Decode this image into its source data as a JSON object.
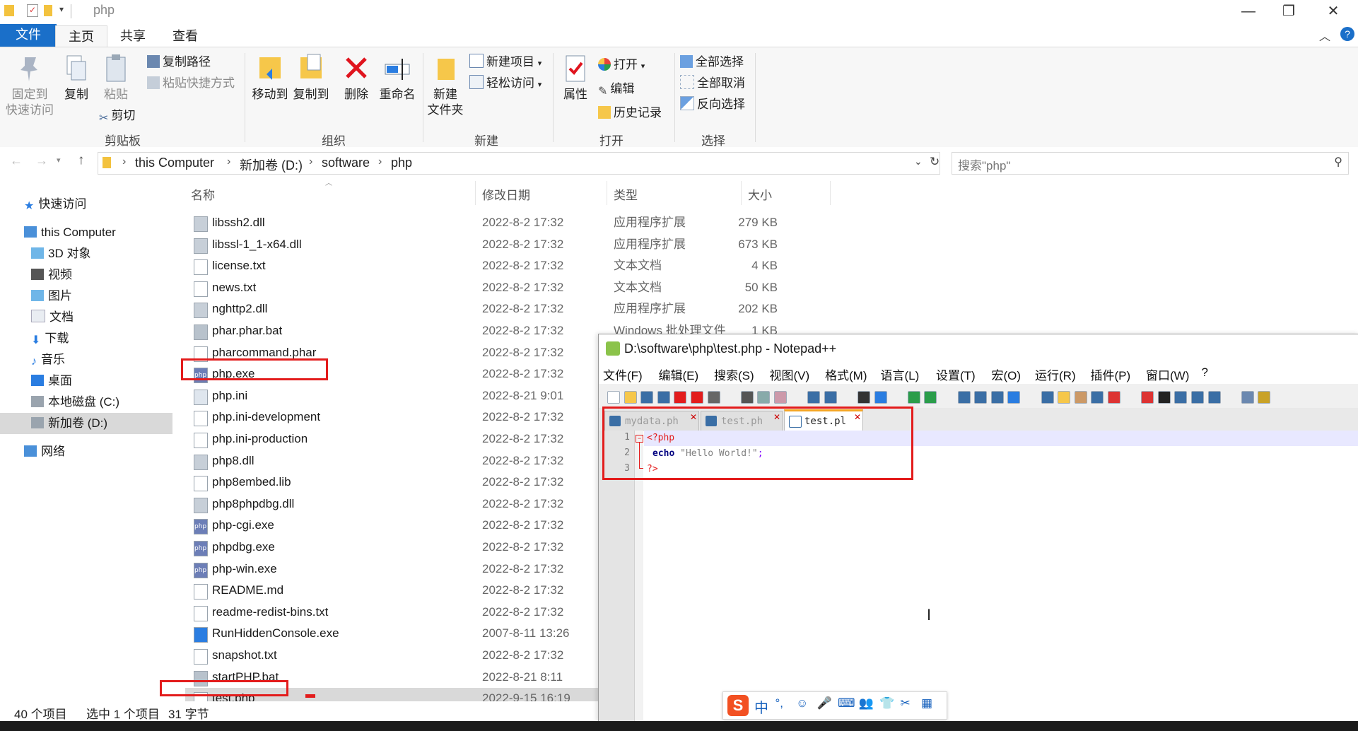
{
  "window": {
    "title": "php",
    "controls": {
      "minimize": "—",
      "maximize": "❐",
      "close": "✕"
    }
  },
  "tabs": {
    "file": "文件",
    "home": "主页",
    "share": "共享",
    "view": "查看"
  },
  "ribbon": {
    "pin": [
      "固定到",
      "快速访问"
    ],
    "copy": "复制",
    "paste": "粘贴",
    "copy_path": "复制路径",
    "paste_shortcut": "粘贴快捷方式",
    "cut": "剪切",
    "group_clipboard": "剪贴板",
    "move_to": "移动到",
    "copy_to": "复制到",
    "delete": "删除",
    "rename": "重命名",
    "group_organize": "组织",
    "new_folder": [
      "新建",
      "文件夹"
    ],
    "new_item": "新建项目",
    "easy_access": "轻松访问",
    "group_new": "新建",
    "properties": "属性",
    "open": "打开",
    "edit": "编辑",
    "history": "历史记录",
    "group_open": "打开",
    "select_all": "全部选择",
    "select_none": "全部取消",
    "invert_selection": "反向选择",
    "group_select": "选择"
  },
  "address": {
    "crumbs": [
      "this Computer",
      "新加卷 (D:)",
      "software",
      "php"
    ],
    "search_placeholder": "搜索\"php\""
  },
  "nav": {
    "items": [
      "快速访问",
      "this Computer",
      "3D 对象",
      "视频",
      "图片",
      "文档",
      "下载",
      "音乐",
      "桌面",
      "本地磁盘 (C:)",
      "新加卷 (D:)",
      "网络"
    ]
  },
  "list": {
    "headers": {
      "name": "名称",
      "date": "修改日期",
      "type": "类型",
      "size": "大小"
    },
    "rows": [
      {
        "name": "libssh2.dll",
        "date": "2022-8-2 17:32",
        "type": "应用程序扩展",
        "size": "279 KB",
        "icon": "dll"
      },
      {
        "name": "libssl-1_1-x64.dll",
        "date": "2022-8-2 17:32",
        "type": "应用程序扩展",
        "size": "673 KB",
        "icon": "dll"
      },
      {
        "name": "license.txt",
        "date": "2022-8-2 17:32",
        "type": "文本文档",
        "size": "4 KB",
        "icon": "txt"
      },
      {
        "name": "news.txt",
        "date": "2022-8-2 17:32",
        "type": "文本文档",
        "size": "50 KB",
        "icon": "txt"
      },
      {
        "name": "nghttp2.dll",
        "date": "2022-8-2 17:32",
        "type": "应用程序扩展",
        "size": "202 KB",
        "icon": "dll"
      },
      {
        "name": "phar.phar.bat",
        "date": "2022-8-2 17:32",
        "type": "Windows 批处理文件",
        "size": "1 KB",
        "icon": "bat"
      },
      {
        "name": "pharcommand.phar",
        "date": "2022-8-2 17:32",
        "icon": "txt"
      },
      {
        "name": "php.exe",
        "date": "2022-8-2 17:32",
        "icon": "php"
      },
      {
        "name": "php.ini",
        "date": "2022-8-21 9:01",
        "icon": "ini"
      },
      {
        "name": "php.ini-development",
        "date": "2022-8-2 17:32",
        "icon": "txt"
      },
      {
        "name": "php.ini-production",
        "date": "2022-8-2 17:32",
        "icon": "txt"
      },
      {
        "name": "php8.dll",
        "date": "2022-8-2 17:32",
        "icon": "dll"
      },
      {
        "name": "php8embed.lib",
        "date": "2022-8-2 17:32",
        "icon": "txt"
      },
      {
        "name": "php8phpdbg.dll",
        "date": "2022-8-2 17:32",
        "icon": "dll"
      },
      {
        "name": "php-cgi.exe",
        "date": "2022-8-2 17:32",
        "icon": "php"
      },
      {
        "name": "phpdbg.exe",
        "date": "2022-8-2 17:32",
        "icon": "php"
      },
      {
        "name": "php-win.exe",
        "date": "2022-8-2 17:32",
        "icon": "php"
      },
      {
        "name": "README.md",
        "date": "2022-8-2 17:32",
        "icon": "txt"
      },
      {
        "name": "readme-redist-bins.txt",
        "date": "2022-8-2 17:32",
        "icon": "txt"
      },
      {
        "name": "RunHiddenConsole.exe",
        "date": "2007-8-11 13:26",
        "icon": "exe"
      },
      {
        "name": "snapshot.txt",
        "date": "2022-8-2 17:32",
        "icon": "txt"
      },
      {
        "name": "startPHP.bat",
        "date": "2022-8-21 8:11",
        "icon": "bat"
      },
      {
        "name": "test.php",
        "date": "2022-9-15 16:19",
        "icon": "txt",
        "selected": true
      }
    ]
  },
  "status": {
    "count": "40 个项目",
    "selected": "选中 1 个项目",
    "bytes": "31 字节"
  },
  "npp": {
    "title": "D:\\software\\php\\test.php - Notepad++",
    "menu": [
      "文件(F)",
      "编辑(E)",
      "搜索(S)",
      "视图(V)",
      "格式(M)",
      "语言(L)",
      "设置(T)",
      "宏(O)",
      "运行(R)",
      "插件(P)",
      "窗口(W)",
      "?"
    ],
    "tabs": [
      {
        "label": "mydata.ph",
        "active": false
      },
      {
        "label": "test.ph",
        "active": false
      },
      {
        "label": "test.pl",
        "active": true
      }
    ],
    "lines": [
      "1",
      "2",
      "3"
    ],
    "code": {
      "l1": "<?php",
      "l2_kw": "echo",
      "l2_str": " \"Hello World!\"",
      "l2_end": ";",
      "l3": "?>"
    }
  },
  "ime": {
    "items": [
      "中",
      "°,",
      "☺",
      "🎤",
      "⌨",
      "👥",
      "👕",
      "✂",
      "▦"
    ]
  },
  "colors": {
    "accent": "#1a6fc9",
    "highlight": "#e31c1c",
    "selected_row": "#d9d9d9"
  }
}
